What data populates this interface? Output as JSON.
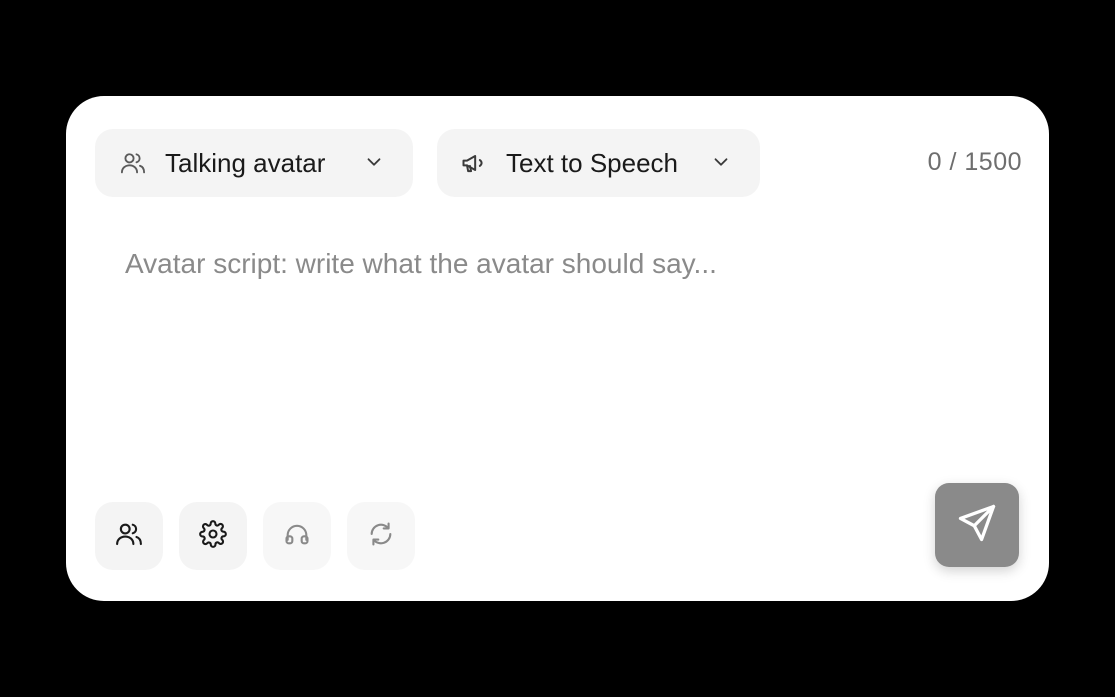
{
  "composer": {
    "avatar_mode": {
      "label": "Talking avatar",
      "icon": "users-icon"
    },
    "voice_mode": {
      "label": "Text to Speech",
      "icon": "megaphone-icon"
    },
    "char_counter": "0 / 1500",
    "script": {
      "value": "",
      "placeholder": "Avatar script: write what the avatar should say..."
    },
    "tools": [
      {
        "name": "avatars",
        "icon": "users-icon"
      },
      {
        "name": "settings",
        "icon": "gear-icon"
      },
      {
        "name": "audio",
        "icon": "headphones-icon"
      },
      {
        "name": "refresh",
        "icon": "refresh-icon"
      }
    ],
    "send": {
      "icon": "send-icon"
    }
  },
  "colors": {
    "background": "#000000",
    "card": "#ffffff",
    "chip": "#f4f4f4",
    "send_button": "#8a8a8a",
    "placeholder": "#8a8a8a",
    "text": "#1a1a1a"
  }
}
